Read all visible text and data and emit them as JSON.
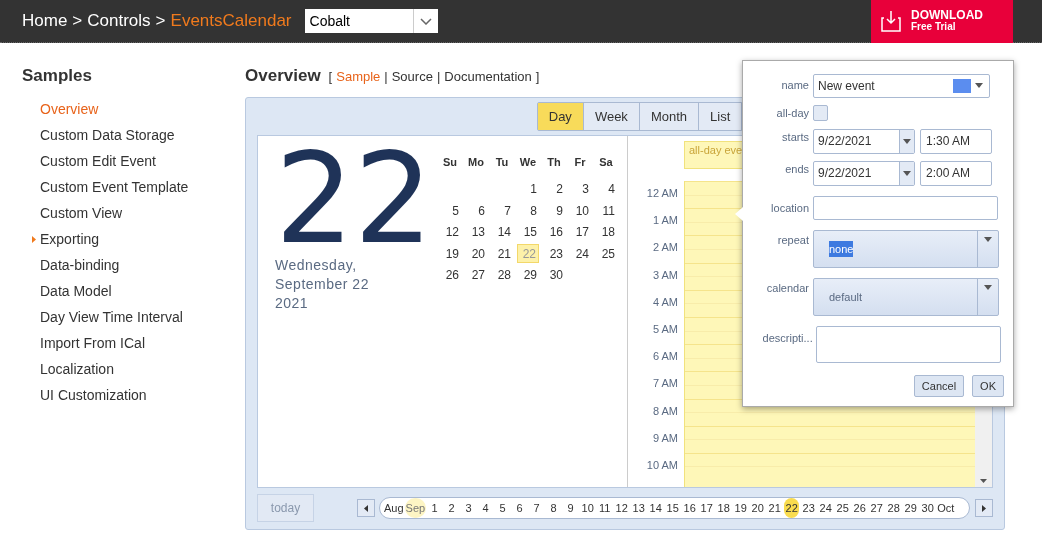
{
  "header": {
    "breadcrumb": [
      {
        "label": "Home",
        "current": false
      },
      {
        "label": "Controls",
        "current": false
      },
      {
        "label": "EventsCalendar",
        "current": true
      }
    ],
    "separator": ">",
    "theme_select": {
      "value": "Cobalt"
    },
    "download": {
      "title": "DOWNLOAD",
      "subtitle": "Free Trial"
    }
  },
  "sidebar": {
    "title": "Samples",
    "items": [
      {
        "label": "Overview",
        "selected": true,
        "expandable": false
      },
      {
        "label": "Custom Data Storage",
        "selected": false,
        "expandable": false
      },
      {
        "label": "Custom Edit Event",
        "selected": false,
        "expandable": false
      },
      {
        "label": "Custom Event Template",
        "selected": false,
        "expandable": false
      },
      {
        "label": "Custom View",
        "selected": false,
        "expandable": false
      },
      {
        "label": "Exporting",
        "selected": false,
        "expandable": true
      },
      {
        "label": "Data-binding",
        "selected": false,
        "expandable": false
      },
      {
        "label": "Data Model",
        "selected": false,
        "expandable": false
      },
      {
        "label": "Day View Time Interval",
        "selected": false,
        "expandable": false
      },
      {
        "label": "Import From ICal",
        "selected": false,
        "expandable": false
      },
      {
        "label": "Localization",
        "selected": false,
        "expandable": false
      },
      {
        "label": "UI Customization",
        "selected": false,
        "expandable": false
      }
    ]
  },
  "page": {
    "title": "Overview",
    "open_bracket": "[",
    "close_bracket": "]",
    "link_separator": "|",
    "links": [
      {
        "label": "Sample",
        "selected": true
      },
      {
        "label": "Source",
        "selected": false
      },
      {
        "label": "Documentation",
        "selected": false
      }
    ]
  },
  "view_tabs": [
    {
      "label": "Day",
      "selected": true
    },
    {
      "label": "Week",
      "selected": false
    },
    {
      "label": "Month",
      "selected": false
    },
    {
      "label": "List",
      "selected": false
    }
  ],
  "big_day": "22",
  "date_text": [
    "Wednesday,",
    "September 22",
    "2021"
  ],
  "mini_calendar": {
    "weekdays": [
      "Su",
      "Mo",
      "Tu",
      "We",
      "Th",
      "Fr",
      "Sa"
    ],
    "weeks": [
      [
        {
          "day": "1",
          "selected": false
        },
        {
          "day": "2",
          "selected": false
        },
        {
          "day": "3",
          "selected": false
        },
        {
          "day": "4",
          "selected": false
        }
      ],
      [
        {
          "day": "5",
          "selected": false
        },
        {
          "day": "6",
          "selected": false
        },
        {
          "day": "7",
          "selected": false
        },
        {
          "day": "8",
          "selected": false
        },
        {
          "day": "9",
          "selected": false
        },
        {
          "day": "10",
          "selected": false
        },
        {
          "day": "11",
          "selected": false
        }
      ],
      [
        {
          "day": "12",
          "selected": false
        },
        {
          "day": "13",
          "selected": false
        },
        {
          "day": "14",
          "selected": false
        },
        {
          "day": "15",
          "selected": false
        },
        {
          "day": "16",
          "selected": false
        },
        {
          "day": "17",
          "selected": false
        },
        {
          "day": "18",
          "selected": false
        }
      ],
      [
        {
          "day": "19",
          "selected": false
        },
        {
          "day": "20",
          "selected": false
        },
        {
          "day": "21",
          "selected": false
        },
        {
          "day": "22",
          "selected": true
        },
        {
          "day": "23",
          "selected": false
        },
        {
          "day": "24",
          "selected": false
        },
        {
          "day": "25",
          "selected": false
        }
      ],
      [
        {
          "day": "26",
          "selected": false
        },
        {
          "day": "27",
          "selected": false
        },
        {
          "day": "28",
          "selected": false
        },
        {
          "day": "29",
          "selected": false
        },
        {
          "day": "30",
          "selected": false
        }
      ]
    ]
  },
  "day_view": {
    "all_day_label": "all-day eve",
    "hours": [
      "12 AM",
      "1 AM",
      "2 AM",
      "3 AM",
      "4 AM",
      "5 AM",
      "6 AM",
      "7 AM",
      "8 AM",
      "9 AM",
      "10 AM"
    ]
  },
  "today_button": "today",
  "date_strip": [
    {
      "label": "Aug",
      "kind": "month",
      "selected": false
    },
    {
      "label": "Sep",
      "kind": "month",
      "selected": true
    },
    {
      "label": "1",
      "kind": "day",
      "selected": false
    },
    {
      "label": "2",
      "kind": "day",
      "selected": false
    },
    {
      "label": "3",
      "kind": "day",
      "selected": false
    },
    {
      "label": "4",
      "kind": "day",
      "selected": false
    },
    {
      "label": "5",
      "kind": "day",
      "selected": false
    },
    {
      "label": "6",
      "kind": "day",
      "selected": false
    },
    {
      "label": "7",
      "kind": "day",
      "selected": false
    },
    {
      "label": "8",
      "kind": "day",
      "selected": false
    },
    {
      "label": "9",
      "kind": "day",
      "selected": false
    },
    {
      "label": "10",
      "kind": "day",
      "selected": false
    },
    {
      "label": "11",
      "kind": "day",
      "selected": false
    },
    {
      "label": "12",
      "kind": "day",
      "selected": false
    },
    {
      "label": "13",
      "kind": "day",
      "selected": false
    },
    {
      "label": "14",
      "kind": "day",
      "selected": false
    },
    {
      "label": "15",
      "kind": "day",
      "selected": false
    },
    {
      "label": "16",
      "kind": "day",
      "selected": false
    },
    {
      "label": "17",
      "kind": "day",
      "selected": false
    },
    {
      "label": "18",
      "kind": "day",
      "selected": false
    },
    {
      "label": "19",
      "kind": "day",
      "selected": false
    },
    {
      "label": "20",
      "kind": "day",
      "selected": false
    },
    {
      "label": "21",
      "kind": "day",
      "selected": false
    },
    {
      "label": "22",
      "kind": "day",
      "selected": true
    },
    {
      "label": "23",
      "kind": "day",
      "selected": false
    },
    {
      "label": "24",
      "kind": "day",
      "selected": false
    },
    {
      "label": "25",
      "kind": "day",
      "selected": false
    },
    {
      "label": "26",
      "kind": "day",
      "selected": false
    },
    {
      "label": "27",
      "kind": "day",
      "selected": false
    },
    {
      "label": "28",
      "kind": "day",
      "selected": false
    },
    {
      "label": "29",
      "kind": "day",
      "selected": false
    },
    {
      "label": "30",
      "kind": "day",
      "selected": false
    },
    {
      "label": "Oct",
      "kind": "month",
      "selected": false
    }
  ],
  "event_popup": {
    "name": {
      "label": "name",
      "value": "New event",
      "color": "#5b8def"
    },
    "all_day": {
      "label": "all-day",
      "checked": false
    },
    "starts": {
      "label": "starts",
      "date": "9/22/2021",
      "time": "1:30 AM"
    },
    "ends": {
      "label": "ends",
      "date": "9/22/2021",
      "time": "2:00 AM"
    },
    "location": {
      "label": "location"
    },
    "repeat": {
      "label": "repeat",
      "value": "none"
    },
    "calendar": {
      "label": "calendar",
      "value": "default"
    },
    "description": {
      "label": "descripti..."
    },
    "buttons": [
      "Cancel",
      "OK"
    ]
  }
}
